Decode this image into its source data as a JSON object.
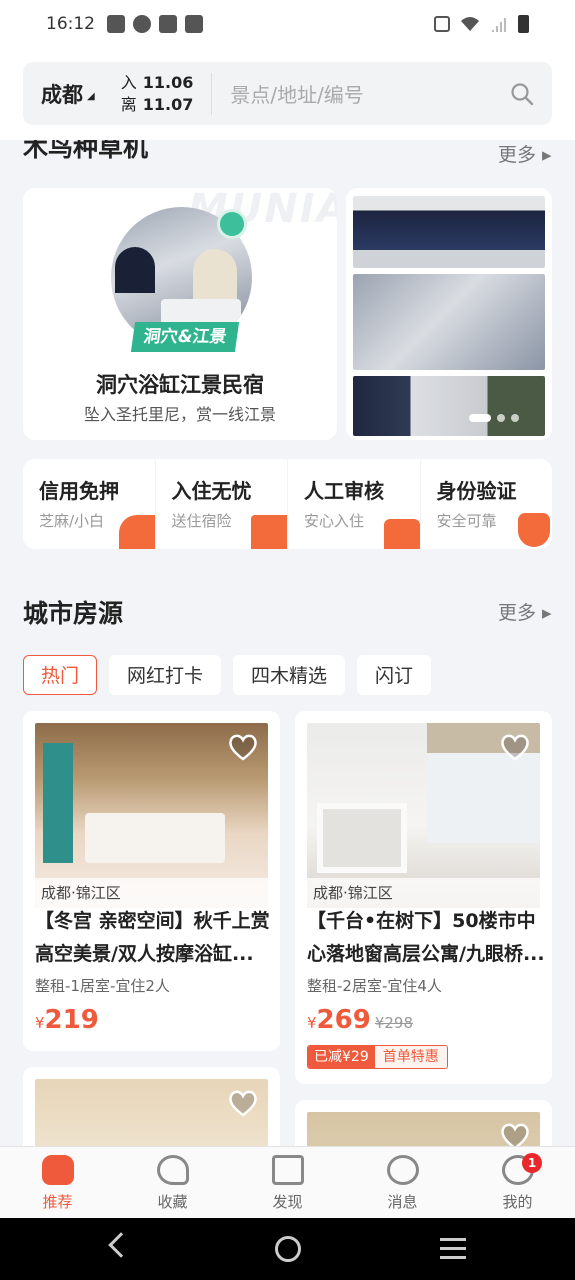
{
  "status_bar": {
    "time": "16:12"
  },
  "header": {
    "city": "成都",
    "checkin_label": "入",
    "checkin_date": "11.06",
    "checkout_label": "离",
    "checkout_date": "11.07",
    "search_placeholder": "景点/地址/编号"
  },
  "featured": {
    "section_title": "木鸟种草机",
    "more_label": "更多",
    "watermark": "MUNIA",
    "tag": "洞穴&江景",
    "title": "洞穴浴缸江景民宿",
    "subtitle": "坠入圣托里尼，赏一线江景"
  },
  "guarantees": [
    {
      "title": "信用免押",
      "subtitle": "芝麻/小白"
    },
    {
      "title": "入住无忧",
      "subtitle": "送住宿险"
    },
    {
      "title": "人工审核",
      "subtitle": "安心入住"
    },
    {
      "title": "身份验证",
      "subtitle": "安全可靠"
    }
  ],
  "city_listings": {
    "section_title": "城市房源",
    "more_label": "更多",
    "tabs": [
      "热门",
      "网红打卡",
      "四木精选",
      "闪订"
    ],
    "active_tab": "热门"
  },
  "listings": [
    {
      "location": "成都·锦江区",
      "title": "【冬宫 亲密空间】秋千上赏高空美景/双人按摩浴缸...",
      "meta": "整租-1居室-宜住2人",
      "currency": "¥",
      "price": "219"
    },
    {
      "location": "成都·锦江区",
      "title": "【千台•在树下】50楼市中心落地窗高层公寓/九眼桥...",
      "meta": "整租-2居室-宜住4人",
      "currency": "¥",
      "price": "269",
      "old_price": "¥298",
      "discount": "已减¥29",
      "promo": "首单特惠"
    }
  ],
  "bottom_nav": [
    {
      "label": "推荐",
      "icon": "home-icon"
    },
    {
      "label": "收藏",
      "icon": "heart-check-icon"
    },
    {
      "label": "发现",
      "icon": "discover-icon"
    },
    {
      "label": "消息",
      "icon": "message-icon"
    },
    {
      "label": "我的",
      "icon": "profile-icon",
      "badge": "1"
    }
  ],
  "colors": {
    "accent": "#f05a3c",
    "teal": "#2fb48f",
    "background": "#f2f4f7"
  }
}
